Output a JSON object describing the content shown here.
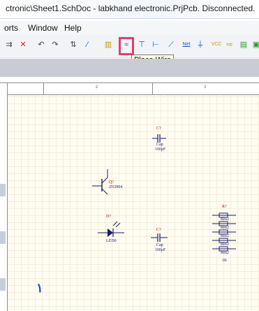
{
  "window": {
    "title": "ctronic\\Sheet1.SchDoc - labkhand electronic.PrjPcb. Disconnected."
  },
  "menu": {
    "items": [
      "orts",
      "Window",
      "Help"
    ]
  },
  "toolbar": {
    "tooltip": "Place Wire",
    "highlight_color": "#e23f6f",
    "tools": [
      {
        "icon": "split-icon"
      },
      {
        "icon": "cross-out-icon"
      },
      {
        "icon": "undo-icon"
      },
      {
        "icon": "redo-icon"
      },
      {
        "icon": "sort-icon"
      },
      {
        "icon": "wand-icon"
      },
      {
        "icon": "chart-icon"
      },
      {
        "icon": "wire-icon"
      },
      {
        "icon": "bus-icon"
      },
      {
        "icon": "signal-harness-icon"
      },
      {
        "icon": "bus-entry-icon"
      },
      {
        "icon": "net-label-icon",
        "label": "Net"
      },
      {
        "icon": "gnd-power-port-icon"
      },
      {
        "icon": "vcc-power-port-icon",
        "label": "VCC"
      },
      {
        "icon": "component-icon"
      },
      {
        "icon": "sheet-symbol-icon"
      },
      {
        "icon": "sheet-entry-icon"
      }
    ]
  },
  "ruler": {
    "marks": [
      "2",
      "3"
    ]
  },
  "components": {
    "cap1": {
      "designator": "C?",
      "name": "Cap",
      "value": "100pF"
    },
    "transistor": {
      "designator": "Q?",
      "name": "2N3904"
    },
    "led": {
      "designator": "D?",
      "name": "LED0"
    },
    "cap2": {
      "designator": "C?",
      "name": "Cap",
      "value": "100pF"
    },
    "resistor_array": {
      "designator": "R?",
      "labels": [
        "Res2",
        "Res2",
        "Res2",
        "Res2",
        "Res2"
      ],
      "value": "1K"
    }
  },
  "canvas_text": {
    "glyph": "١"
  }
}
